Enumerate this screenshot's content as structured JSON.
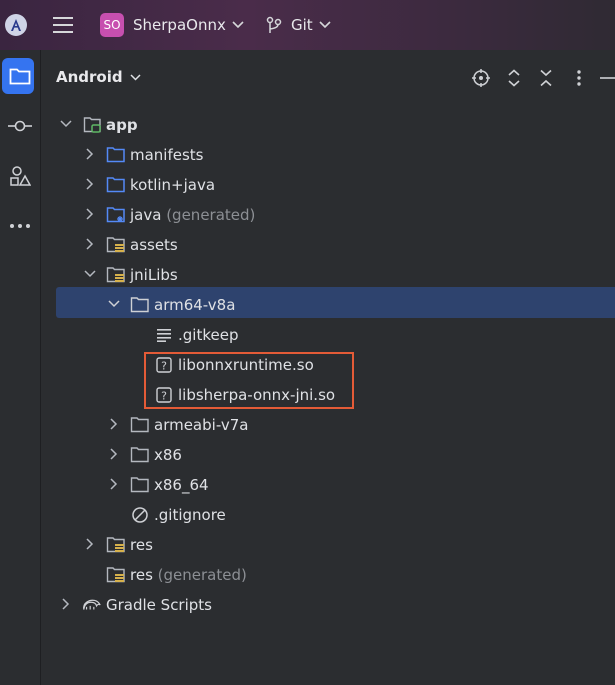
{
  "topbar": {
    "project_badge": "SO",
    "project_name": "SherpaOnnx",
    "vcs_label": "Git"
  },
  "panel": {
    "title": "Android"
  },
  "tree": [
    {
      "label": "app",
      "suffix": ""
    },
    {
      "label": "manifests",
      "suffix": ""
    },
    {
      "label": "kotlin+java",
      "suffix": ""
    },
    {
      "label": "java",
      "suffix": " (generated)"
    },
    {
      "label": "assets",
      "suffix": ""
    },
    {
      "label": "jniLibs",
      "suffix": ""
    },
    {
      "label": "arm64-v8a",
      "suffix": ""
    },
    {
      "label": ".gitkeep",
      "suffix": ""
    },
    {
      "label": "libonnxruntime.so",
      "suffix": ""
    },
    {
      "label": "libsherpa-onnx-jni.so",
      "suffix": ""
    },
    {
      "label": "armeabi-v7a",
      "suffix": ""
    },
    {
      "label": "x86",
      "suffix": ""
    },
    {
      "label": "x86_64",
      "suffix": ""
    },
    {
      "label": ".gitignore",
      "suffix": ""
    },
    {
      "label": "res",
      "suffix": ""
    },
    {
      "label": "res",
      "suffix": " (generated)"
    },
    {
      "label": "Gradle Scripts",
      "suffix": ""
    }
  ],
  "colors": {
    "accent": "#3574f0",
    "selection": "#2e436e",
    "highlight_box": "#e45b37",
    "folder": "#548af7",
    "project_badge": "#c74faf"
  }
}
